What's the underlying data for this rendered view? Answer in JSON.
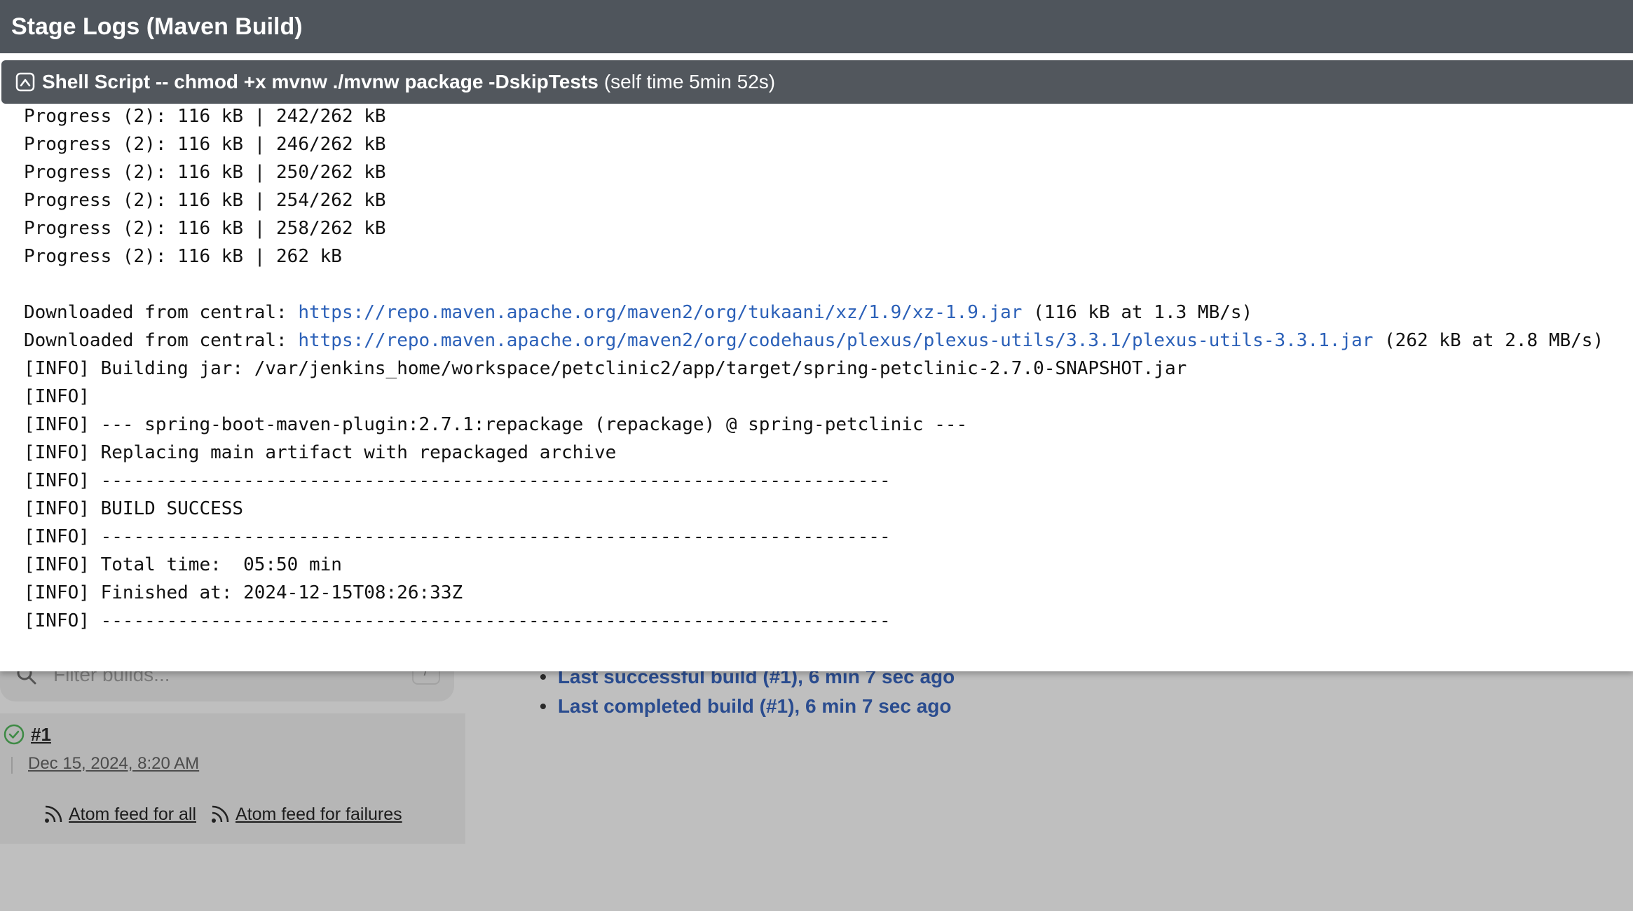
{
  "modal": {
    "title": "Stage Logs (Maven Build)",
    "step": {
      "title": "Shell Script -- chmod +x mvnw ./mvnw package -DskipTests",
      "self_time": "(self time 5min 52s)"
    },
    "log_lines": [
      {
        "text": "Progress (2): 116 kB | 242/262 kB"
      },
      {
        "text": "Progress (2): 116 kB | 246/262 kB"
      },
      {
        "text": "Progress (2): 116 kB | 250/262 kB"
      },
      {
        "text": "Progress (2): 116 kB | 254/262 kB"
      },
      {
        "text": "Progress (2): 116 kB | 258/262 kB"
      },
      {
        "text": "Progress (2): 116 kB | 262 kB"
      },
      {
        "text": ""
      },
      {
        "prefix": "Downloaded from central: ",
        "link": "https://repo.maven.apache.org/maven2/org/tukaani/xz/1.9/xz-1.9.jar",
        "suffix": " (116 kB at 1.3 MB/s)"
      },
      {
        "prefix": "Downloaded from central: ",
        "link": "https://repo.maven.apache.org/maven2/org/codehaus/plexus/plexus-utils/3.3.1/plexus-utils-3.3.1.jar",
        "suffix": " (262 kB at 2.8 MB/s)"
      },
      {
        "text": "[INFO] Building jar: /var/jenkins_home/workspace/petclinic2/app/target/spring-petclinic-2.7.0-SNAPSHOT.jar"
      },
      {
        "text": "[INFO]"
      },
      {
        "text": "[INFO] --- spring-boot-maven-plugin:2.7.1:repackage (repackage) @ spring-petclinic ---"
      },
      {
        "text": "[INFO] Replacing main artifact with repackaged archive"
      },
      {
        "text": "[INFO] ------------------------------------------------------------------------"
      },
      {
        "text": "[INFO] BUILD SUCCESS"
      },
      {
        "text": "[INFO] ------------------------------------------------------------------------"
      },
      {
        "text": "[INFO] Total time:  05:50 min"
      },
      {
        "text": "[INFO] Finished at: 2024-12-15T08:26:33Z"
      },
      {
        "text": "[INFO] ------------------------------------------------------------------------"
      }
    ]
  },
  "background": {
    "filter": {
      "placeholder": "Filter builds...",
      "shortcut": "/"
    },
    "builds": [
      {
        "number": "#1",
        "date": "Dec 15, 2024, 8:20 AM",
        "status": "success"
      }
    ],
    "feeds": {
      "all": "Atom feed for all",
      "failures": "Atom feed for failures"
    },
    "permalinks": [
      "Last successful build (#1), 6 min 7 sec ago",
      "Last completed build (#1), 6 min 7 sec ago"
    ]
  },
  "colors": {
    "header_bg": "#4f555c",
    "log_link": "#2b60b8",
    "success": "#3e8a45",
    "permalink": "#2a4c8f"
  }
}
